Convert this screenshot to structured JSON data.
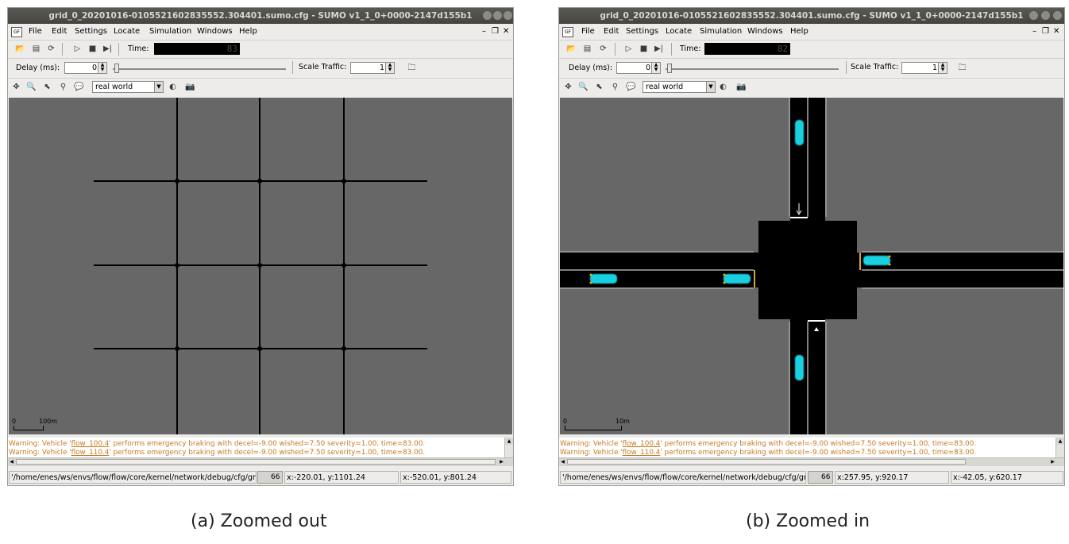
{
  "windows": [
    {
      "id": "a",
      "title": "grid_0_20201016-0105521602835552.304401.sumo.cfg - SUMO v1_1_0+0000-2147d155b1",
      "menu": [
        "File",
        "Edit",
        "Settings",
        "Locate",
        "Simulation",
        "Windows",
        "Help"
      ],
      "mdi_controls": [
        "–",
        "❐",
        "✕"
      ],
      "time_label": "Time:",
      "time_value": "83",
      "delay_label": "Delay (ms):",
      "delay_value": "0",
      "scale_traffic_label": "Scale Traffic:",
      "scale_traffic_value": "1",
      "view_scheme": "real world",
      "scale_zero": "0",
      "scale_length": "100m",
      "messages": [
        {
          "pre": "Warning: Vehicle '",
          "link": "flow_100.4",
          "post": "' performs emergency braking with decel=-9.00 wished=7.50 severity=1.00, time=83.00."
        },
        {
          "pre": "Warning: Vehicle '",
          "link": "flow_110.4",
          "post": "' performs emergency braking with decel=-9.00 wished=7.50 severity=1.00, time=83.00."
        }
      ],
      "status_path": "'/home/enes/ws/envs/flow/flow/core/kernel/network/debug/cfg/grid",
      "vehicle_count": "66",
      "coord_1": "x:-220.01, y:1101.24",
      "coord_2": "x:-520.01, y:801.24"
    },
    {
      "id": "b",
      "title": "grid_0_20201016-0105521602835552.304401.sumo.cfg - SUMO v1_1_0+0000-2147d155b1",
      "menu": [
        "File",
        "Edit",
        "Settings",
        "Locate",
        "Simulation",
        "Windows",
        "Help"
      ],
      "mdi_controls": [
        "–",
        "❐",
        "✕"
      ],
      "time_label": "Time:",
      "time_value": "82",
      "delay_label": "Delay (ms):",
      "delay_value": "0",
      "scale_traffic_label": "Scale Traffic:",
      "scale_traffic_value": "1",
      "view_scheme": "real world",
      "scale_zero": "0",
      "scale_length": "10m",
      "messages": [
        {
          "pre": "Warning: Vehicle '",
          "link": "flow_100.4",
          "post": "' performs emergency braking with decel=-9.00 wished=7.50 severity=1.00, time=83.00."
        },
        {
          "pre": "Warning: Vehicle '",
          "link": "flow_110.4",
          "post": "' performs emergency braking with decel=-9.00 wished=7.50 severity=1.00, time=83.00."
        }
      ],
      "status_path": "'/home/enes/ws/envs/flow/flow/core/kernel/network/debug/cfg/grid",
      "vehicle_count": "66",
      "coord_1": "x:257.95, y:920.17",
      "coord_2": "x:-42.05, y:620.17"
    }
  ],
  "captions": {
    "a": "(a) Zoomed out",
    "b": "(b) Zoomed in"
  },
  "colors": {
    "canvas_bg": "#676767",
    "road": "#000000",
    "vehicle": "#18d0e0",
    "warning_text": "#c87a22"
  }
}
